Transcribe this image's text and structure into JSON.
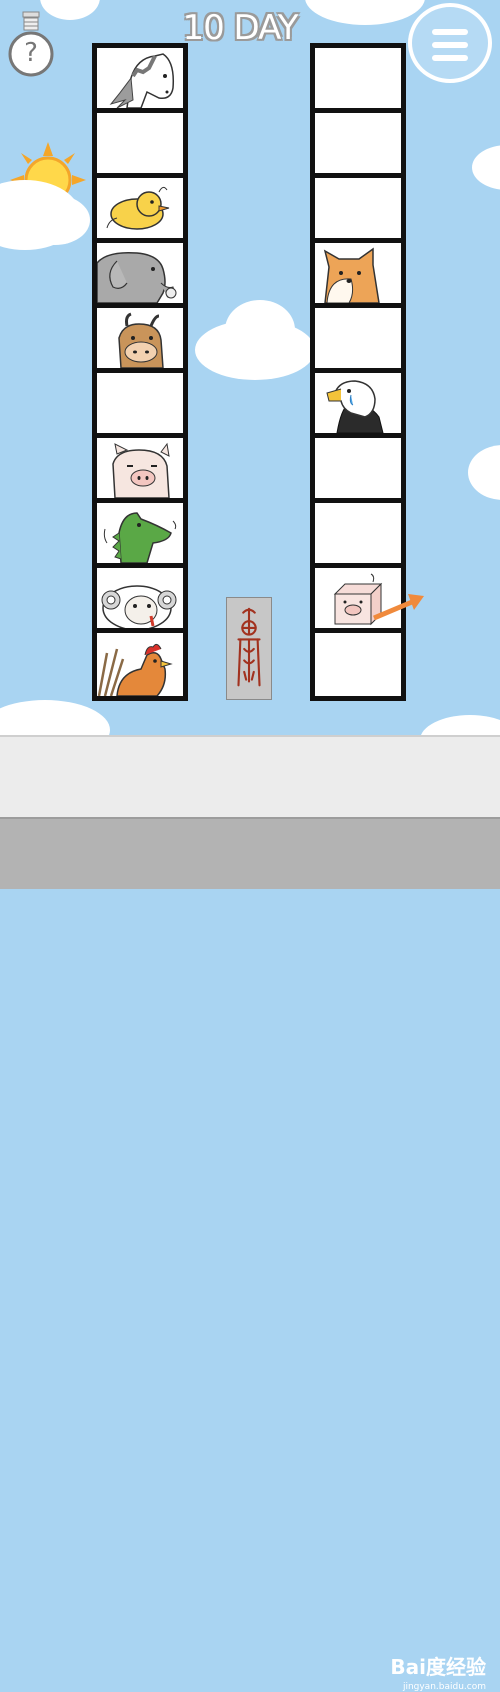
{
  "header": {
    "day_label": "10 DAY"
  },
  "buttons": {
    "hint_label": "?"
  },
  "left_column": [
    {
      "animal": "horse"
    },
    {
      "animal": ""
    },
    {
      "animal": "chick"
    },
    {
      "animal": "elephant"
    },
    {
      "animal": "ox"
    },
    {
      "animal": ""
    },
    {
      "animal": "pig"
    },
    {
      "animal": "crocodile"
    },
    {
      "animal": "sheep"
    },
    {
      "animal": "rooster"
    }
  ],
  "right_column": [
    {
      "animal": ""
    },
    {
      "animal": ""
    },
    {
      "animal": ""
    },
    {
      "animal": "fox"
    },
    {
      "animal": ""
    },
    {
      "animal": "eagle"
    },
    {
      "animal": ""
    },
    {
      "animal": ""
    },
    {
      "animal": "pig-box"
    },
    {
      "animal": ""
    }
  ],
  "colors": {
    "sky": "#a9d4f2",
    "arrow": "#f08a3c",
    "stone": "#c7c7c7",
    "glyph": "#a2321f"
  },
  "watermark": {
    "brand": "Bai度经验",
    "url": "jingyan.baidu.com"
  }
}
